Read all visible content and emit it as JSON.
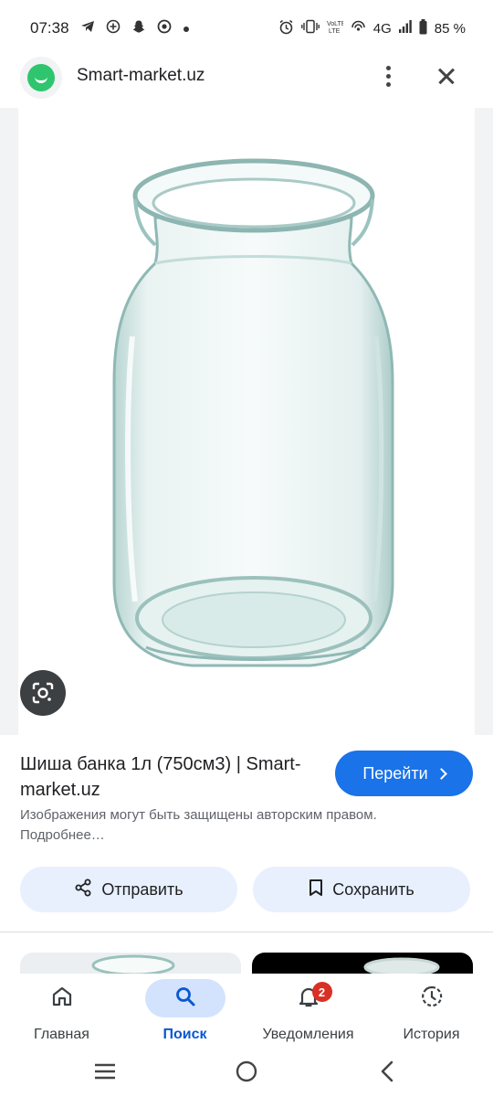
{
  "status_bar": {
    "time": "07:38",
    "battery": "85 %",
    "network": "4G",
    "notification_icons": [
      "telegram-icon",
      "add-circle-icon",
      "snapchat-icon",
      "chrome-icon",
      "dot-icon"
    ],
    "system_icons": [
      "alarm-icon",
      "vibrate-icon",
      "volte-icon",
      "hotspot-icon",
      "signal-icon",
      "battery-icon"
    ]
  },
  "header": {
    "site_name": "Smart-market.uz"
  },
  "result": {
    "title": "Шиша банка 1л (750см3) | Smart-market.uz",
    "visit_label": "Перейти",
    "copyright": "Изображения могут быть защищены авторским правом. Подробнее…"
  },
  "actions": {
    "share_label": "Отправить",
    "save_label": "Сохранить"
  },
  "bottom_nav": {
    "items": [
      {
        "label": "Главная",
        "icon": "home-icon",
        "active": false
      },
      {
        "label": "Поиск",
        "icon": "search-icon",
        "active": true
      },
      {
        "label": "Уведомления",
        "icon": "bell-icon",
        "active": false,
        "badge": "2"
      },
      {
        "label": "История",
        "icon": "history-icon",
        "active": false
      }
    ]
  },
  "colors": {
    "accent": "#1a73e8",
    "active_pill": "#d3e3fd",
    "button_bg": "#e8f0fe",
    "logo_green": "#2fc56e",
    "badge_red": "#d93025"
  }
}
